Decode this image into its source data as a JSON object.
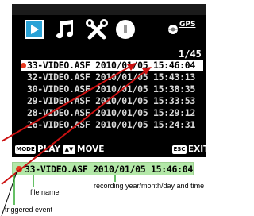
{
  "status_bar": {
    "gps_label": "GPS"
  },
  "menu_icons": [
    "video-icon",
    "music-icon",
    "tools-icon",
    "info-icon"
  ],
  "file_list": {
    "counter": "1/45",
    "files": [
      {
        "name": "33-VIDEO.ASF",
        "date": "2010/01/05",
        "time": "15:46:04",
        "selected": true
      },
      {
        "name": "32-VIDEO.ASF",
        "date": "2010/01/05",
        "time": "15:43:13",
        "selected": false
      },
      {
        "name": "30-VIDEO.ASF",
        "date": "2010/01/05",
        "time": "15:38:35",
        "selected": false
      },
      {
        "name": "29-VIDEO.ASF",
        "date": "2010/01/05",
        "time": "15:33:53",
        "selected": false
      },
      {
        "name": "28-VIDEO.ASF",
        "date": "2010/01/05",
        "time": "15:29:12",
        "selected": false
      },
      {
        "name": "26-VIDEO.ASF",
        "date": "2010/01/05",
        "time": "15:24:31",
        "selected": false
      }
    ]
  },
  "controls": {
    "mode_key": "MODE",
    "play_label": "PLAY",
    "move_key": "▲▼",
    "move_label": "MOVE",
    "esc_key": "ESC",
    "exit_label": "EXIT"
  },
  "callout": {
    "text": "33-VIDEO.ASF 2010/01/05 15:46:04",
    "labels": {
      "file_name": "file name",
      "recording": "recording year/month/day and time",
      "triggered": "triggered event"
    }
  },
  "colors": {
    "selection_dot": "#e6391f",
    "callout_bg": "#b3e8a8",
    "video_icon": "#2aa2d6",
    "arrow": "#cc1111"
  }
}
